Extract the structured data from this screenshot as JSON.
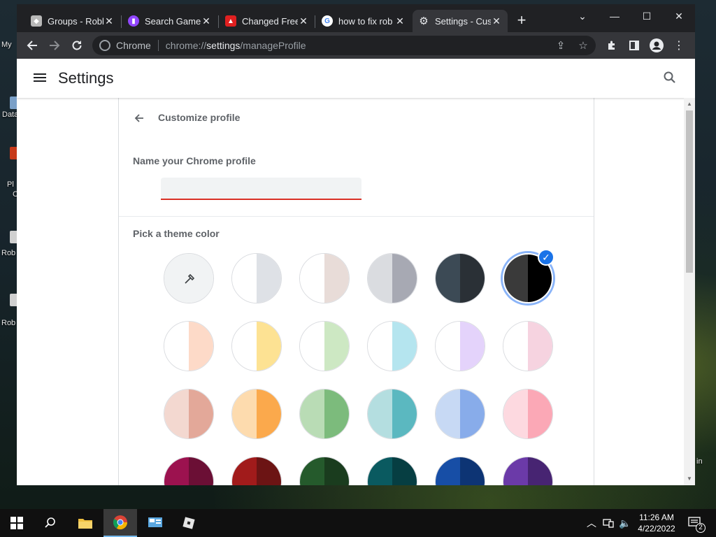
{
  "desktop": {
    "labels": [
      "My",
      "Data",
      "Pl",
      "C",
      "Rob",
      "Rob",
      "in"
    ]
  },
  "browser": {
    "tabs": [
      {
        "title": "Groups - Roblox",
        "favicon": "roblox-icon",
        "active": false
      },
      {
        "title": "Search Games",
        "favicon": "twitch-icon",
        "active": false
      },
      {
        "title": "Changed Free",
        "favicon": "roblox-red-icon",
        "active": false
      },
      {
        "title": "how to fix rob",
        "favicon": "google-icon",
        "active": false
      },
      {
        "title": "Settings - Cus",
        "favicon": "settings-gear-icon",
        "active": true
      }
    ],
    "new_tab_label": "+",
    "window_controls": {
      "dropdown": "⌄",
      "minimize": "—",
      "maximize": "☐",
      "close": "✕"
    },
    "omnibox": {
      "chip_label": "Chrome",
      "url_scheme": "chrome://",
      "url_host": "settings",
      "url_path": "/manageProfile"
    }
  },
  "settings": {
    "title": "Settings",
    "page_title": "Customize profile",
    "name_label": "Name your Chrome profile",
    "name_value": "",
    "theme_label": "Pick a theme color",
    "swatches": [
      {
        "left": "#f1f3f4",
        "right": "#f1f3f4",
        "kind": "custom",
        "selected": false
      },
      {
        "left": "#ffffff",
        "right": "#dee1e6",
        "selected": false
      },
      {
        "left": "#ffffff",
        "right": "#e8dcd8",
        "selected": false
      },
      {
        "left": "#dadce0",
        "right": "#a7a9b3",
        "selected": false
      },
      {
        "left": "#3c4a55",
        "right": "#2a3036",
        "selected": false
      },
      {
        "left": "#3a3a3a",
        "right": "#000000",
        "selected": true
      },
      {
        "left": "#ffffff",
        "right": "#fddac8",
        "selected": false
      },
      {
        "left": "#ffffff",
        "right": "#fde293",
        "selected": false
      },
      {
        "left": "#ffffff",
        "right": "#cde8c3",
        "selected": false
      },
      {
        "left": "#ffffff",
        "right": "#b5e5ef",
        "selected": false
      },
      {
        "left": "#ffffff",
        "right": "#e4d3fb",
        "selected": false
      },
      {
        "left": "#ffffff",
        "right": "#f6d3e0",
        "selected": false
      },
      {
        "left": "#f3d8d0",
        "right": "#e3a899",
        "selected": false
      },
      {
        "left": "#fddbae",
        "right": "#fba94c",
        "selected": false
      },
      {
        "left": "#b9dcb5",
        "right": "#7cbb7c",
        "selected": false
      },
      {
        "left": "#b4dee0",
        "right": "#5bb8c0",
        "selected": false
      },
      {
        "left": "#c7d9f4",
        "right": "#88acea",
        "selected": false
      },
      {
        "left": "#fdd9e0",
        "right": "#fba8b6",
        "selected": false
      },
      {
        "left": "#9c124f",
        "right": "#6b0f35",
        "selected": false
      },
      {
        "left": "#a11b1b",
        "right": "#6c1414",
        "selected": false
      },
      {
        "left": "#255a2c",
        "right": "#1a3c1e",
        "selected": false
      },
      {
        "left": "#0a5a60",
        "right": "#063e42",
        "selected": false
      },
      {
        "left": "#174ea6",
        "right": "#0d3474",
        "selected": false
      },
      {
        "left": "#6b3aa8",
        "right": "#472472",
        "selected": false
      }
    ]
  },
  "taskbar": {
    "time": "11:26 AM",
    "date": "4/22/2022",
    "notification_count": "2"
  }
}
